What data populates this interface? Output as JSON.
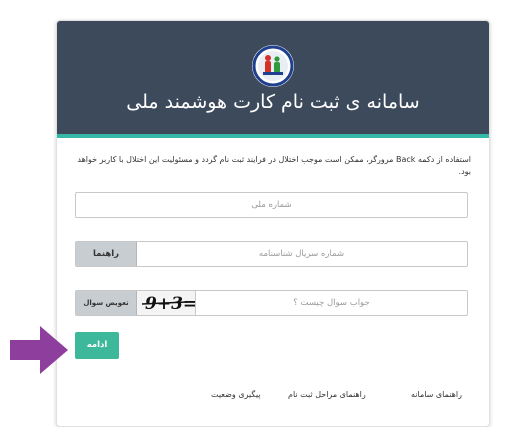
{
  "header": {
    "title": "سامانه ی ثبت نام کارت هوشمند ملی",
    "logo": "national-card-logo",
    "background_color": "#3d4a5c",
    "accent_color": "#35b8a7"
  },
  "warning_text": "استفاده از دکمه Back مرورگر، ممکن است موجب اختلال در فرایند ثبت نام گردد و مسئولیت این اختلال با کاربر خواهد بود.",
  "form": {
    "national_code_placeholder": "شماره ملی",
    "serial_placeholder": "شماره سریال شناسنامه",
    "guide_button": "راهنما",
    "captcha_placeholder": "جواب سوال چیست ؟",
    "captcha_refresh_button": "تعویض سوال",
    "captcha_image_text": "9+3=",
    "continue_button": "ادامه",
    "continue_color": "#3db89a"
  },
  "footer": {
    "system_guide": "راهنمای سامانه",
    "registration_steps_guide": "راهنمای مراحل ثبت نام",
    "status_tracking": "پیگیری وضعیت"
  },
  "annotation": {
    "arrow_color": "#8e3f9e"
  }
}
